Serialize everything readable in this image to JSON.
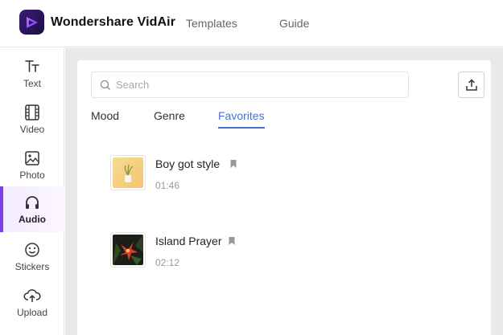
{
  "app": {
    "name": "Wondershare VidAir",
    "logo_icon": "vidair-logo-icon",
    "accent": "#7b3fe4"
  },
  "topnav": {
    "items": [
      {
        "label": "Templates"
      },
      {
        "label": "Guide"
      }
    ]
  },
  "sidebar": {
    "items": [
      {
        "label": "Text",
        "icon": "text-icon"
      },
      {
        "label": "Video",
        "icon": "film-icon"
      },
      {
        "label": "Photo",
        "icon": "image-icon"
      },
      {
        "label": "Audio",
        "icon": "headphones-icon",
        "active": true
      },
      {
        "label": "Stickers",
        "icon": "smiley-icon"
      },
      {
        "label": "Upload",
        "icon": "cloud-upload-icon"
      }
    ]
  },
  "search": {
    "placeholder": "Search",
    "value": ""
  },
  "upload_button": {
    "icon": "upload-icon"
  },
  "tabs": {
    "items": [
      {
        "label": "Mood"
      },
      {
        "label": "Genre"
      },
      {
        "label": "Favorites",
        "active": true
      }
    ],
    "active_color": "#4a6fd6"
  },
  "tracks": [
    {
      "title": "Boy got style",
      "duration": "01:46",
      "bookmarked": true
    },
    {
      "title": "Island Prayer",
      "duration": "02:12",
      "bookmarked": true
    }
  ]
}
